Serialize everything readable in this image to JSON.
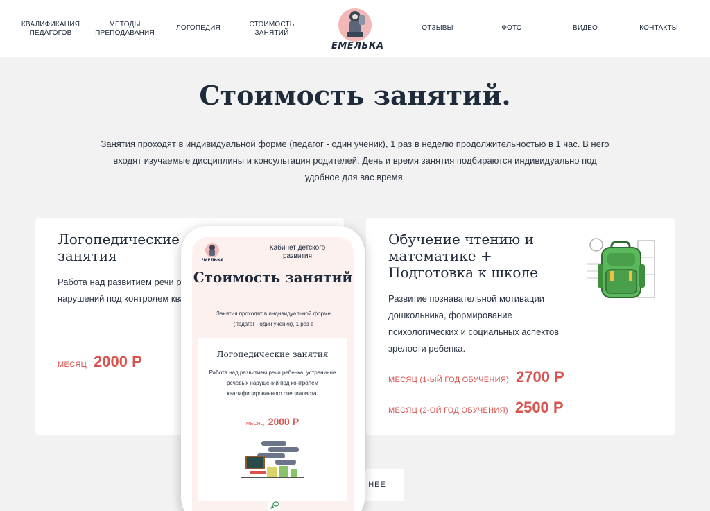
{
  "header": {
    "nav_left": [
      {
        "label": "КВАЛИФИКАЦИЯ\nПЕДАГОГОВ"
      },
      {
        "label": "МЕТОДЫ\nПРЕПОДАВАНИЯ"
      },
      {
        "label": "ЛОГОПЕДИЯ"
      },
      {
        "label": "СТОИМОСТЬ\nЗАНЯТИЙ"
      }
    ],
    "logo_text": "ЕМЕЛЬКА",
    "nav_right": [
      {
        "label": "ОТЗЫВЫ"
      },
      {
        "label": "ФОТО"
      },
      {
        "label": "ВИДЕО"
      },
      {
        "label": "КОНТАКТЫ"
      }
    ]
  },
  "hero": {
    "title": "Стоимость занятий.",
    "intro": "Занятия проходят в индивидуальной форме (педагог - один ученик), 1 раз в неделю продолжительностью в 1 час. В него входят изучаемые дисциплины и консультация родителей. День и время занятия подбираются индивидуально под удобное для вас время."
  },
  "cards": {
    "speech": {
      "title": "Логопедические\nзанятия",
      "text": "Работа над развитием речи ребенка, устраниние речевых нарушений под контролем квалифицированного специалиста.",
      "price_label": "МЕСЯЦ",
      "price_value": "2000 Р"
    },
    "reading": {
      "title": "Обучение чтению и\nматематике +\nПодготовка к школе",
      "text": "Развитие познавательной мотивации дошкольника, формирование психологических и социальных аспектов зрелости ребенка.",
      "prices": [
        {
          "label": "МЕСЯЦ (1-ЫЙ ГОД ОБУЧЕНИЯ)",
          "value": "2700 Р"
        },
        {
          "label": "МЕСЯЦ (2-ОЙ ГОД ОБУЧЕНИЯ)",
          "value": "2500 Р"
        }
      ]
    }
  },
  "more_button": {
    "label": "НЕЕ"
  },
  "mobile": {
    "subtitle": "Кабинет детского развития",
    "title": "Стоимость занятий",
    "intro": "Занятия проходят в индивидуальной форме (педагог - один ученик), 1 раз в",
    "card": {
      "title": "Логопедические занятия",
      "text": "Работа над развитием речи ребенка, устраниние речевых нарушений под контролем квалифицированного специалиста.",
      "price_label": "МЕСЯЦ",
      "price_value": "2000 Р"
    }
  },
  "colors": {
    "accent": "#d9534f",
    "text": "#1f2a3a",
    "background": "#f2f2f2",
    "backpack_green": "#5cb85c"
  },
  "icons": [
    "logo-mascot-icon",
    "backpack-icon",
    "classroom-illustration-icon",
    "chat-icon"
  ]
}
